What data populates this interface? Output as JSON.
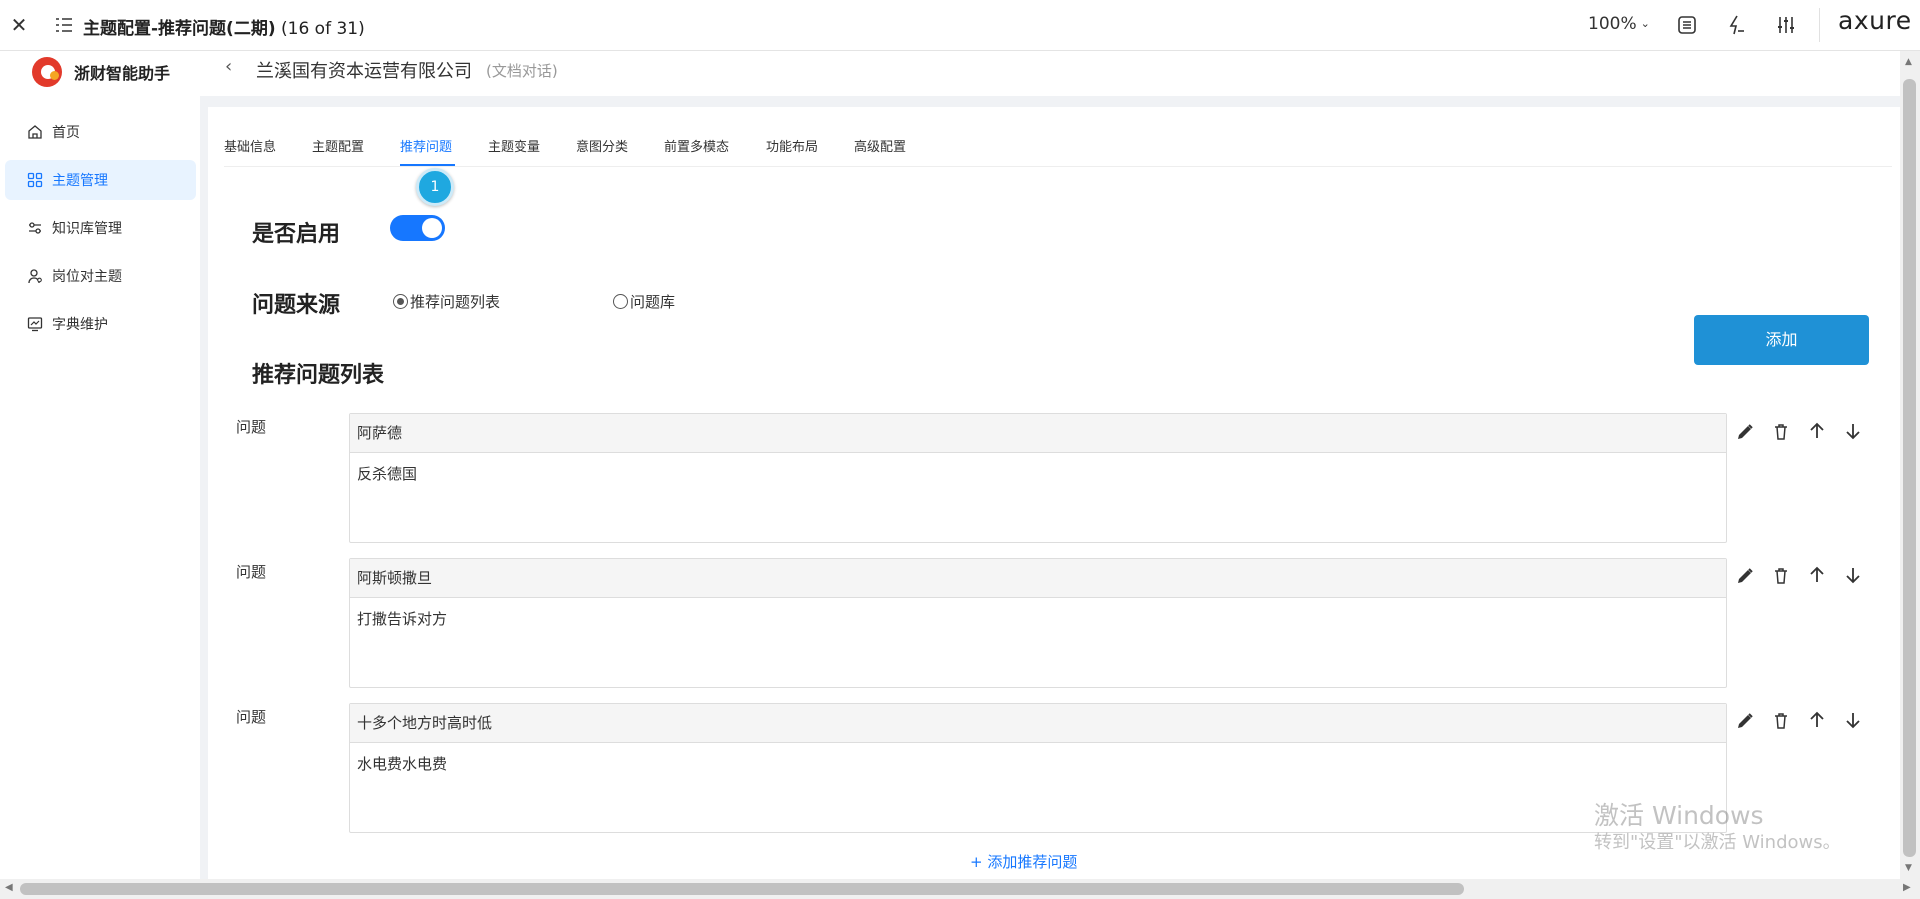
{
  "axure_bar": {
    "close_glyph": "✕",
    "title_bold": "主题配置-推荐问题(二期)",
    "title_count": " (16 of 31)",
    "zoom": "100%",
    "logo": "axure"
  },
  "app": {
    "brand_name": "浙财智能助手",
    "nav": [
      {
        "label": "首页",
        "icon": "home-icon"
      },
      {
        "label": "主题管理",
        "icon": "grid-icon",
        "active": true
      },
      {
        "label": "知识库管理",
        "icon": "sliders-icon"
      },
      {
        "label": "岗位对主题",
        "icon": "user-icon"
      },
      {
        "label": "字典维护",
        "icon": "chart-icon"
      }
    ]
  },
  "header": {
    "back_glyph": "‹",
    "title": "兰溪国有资本运营有限公司",
    "subtitle": "(文档对话)"
  },
  "tabs": [
    "基础信息",
    "主题配置",
    "推荐问题",
    "主题变量",
    "意图分类",
    "前置多模态",
    "功能布局",
    "高级配置"
  ],
  "active_tab": "推荐问题",
  "marker": "1",
  "form": {
    "enable_label": "是否启用",
    "enabled": true,
    "source_label": "问题来源",
    "source_options": [
      "推荐问题列表",
      "问题库"
    ],
    "source_selected": "推荐问题列表",
    "list_title": "推荐问题列表",
    "add_button": "添加",
    "add_question_link": "+ 添加推荐问题"
  },
  "questions": [
    {
      "label": "问题",
      "title": "阿萨德",
      "answer": "反杀德国"
    },
    {
      "label": "问题",
      "title": "阿斯顿撒旦",
      "answer": "打撒告诉对方"
    },
    {
      "label": "问题",
      "title": "十多个地方时高时低",
      "answer": "水电费水电费"
    }
  ],
  "watermark": {
    "line1": "激活 Windows",
    "line2": "转到\"设置\"以激活 Windows。"
  },
  "colors": {
    "accent": "#1677ff",
    "add_button": "#1f91d6",
    "marker": "#1fa8e0",
    "brand_red": "#e23a2b"
  }
}
